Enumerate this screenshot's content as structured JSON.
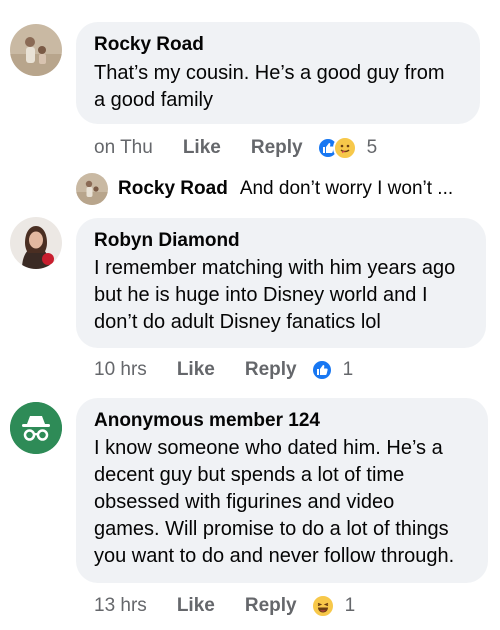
{
  "comments": [
    {
      "author": "Rocky Road",
      "lines": [
        "That’s my cousin. He’s a good guy from",
        "a good family"
      ],
      "time": "on Thu",
      "like": "Like",
      "reply": "Reply",
      "reaction_count": "5",
      "reactions": [
        "like-icon",
        "care-icon"
      ]
    },
    {
      "author": "Robyn Diamond",
      "lines": [
        "I remember matching with him years ago",
        "but he is huge into Disney world and I",
        "don’t do adult Disney fanatics lol"
      ],
      "time": "10 hrs",
      "like": "Like",
      "reply": "Reply",
      "reaction_count": "1",
      "reactions": [
        "like-icon"
      ]
    },
    {
      "author": "Anonymous member 124",
      "lines": [
        "I know someone who dated him. He’s a",
        "decent guy but spends a lot of time",
        "obsessed with figurines and video",
        "games. Will promise to do a lot of things",
        "you want to do and never follow through."
      ],
      "time": "13 hrs",
      "like": "Like",
      "reply": "Reply",
      "reaction_count": "1",
      "reactions": [
        "haha-icon"
      ]
    }
  ],
  "reply_preview": {
    "author": "Rocky Road",
    "text": "And don’t worry I won’t ..."
  },
  "colors": {
    "bubble": "#f0f2f5",
    "meta_text": "#65676b",
    "like_blue": "#1877f2",
    "anon_green": "#2e8b57"
  }
}
